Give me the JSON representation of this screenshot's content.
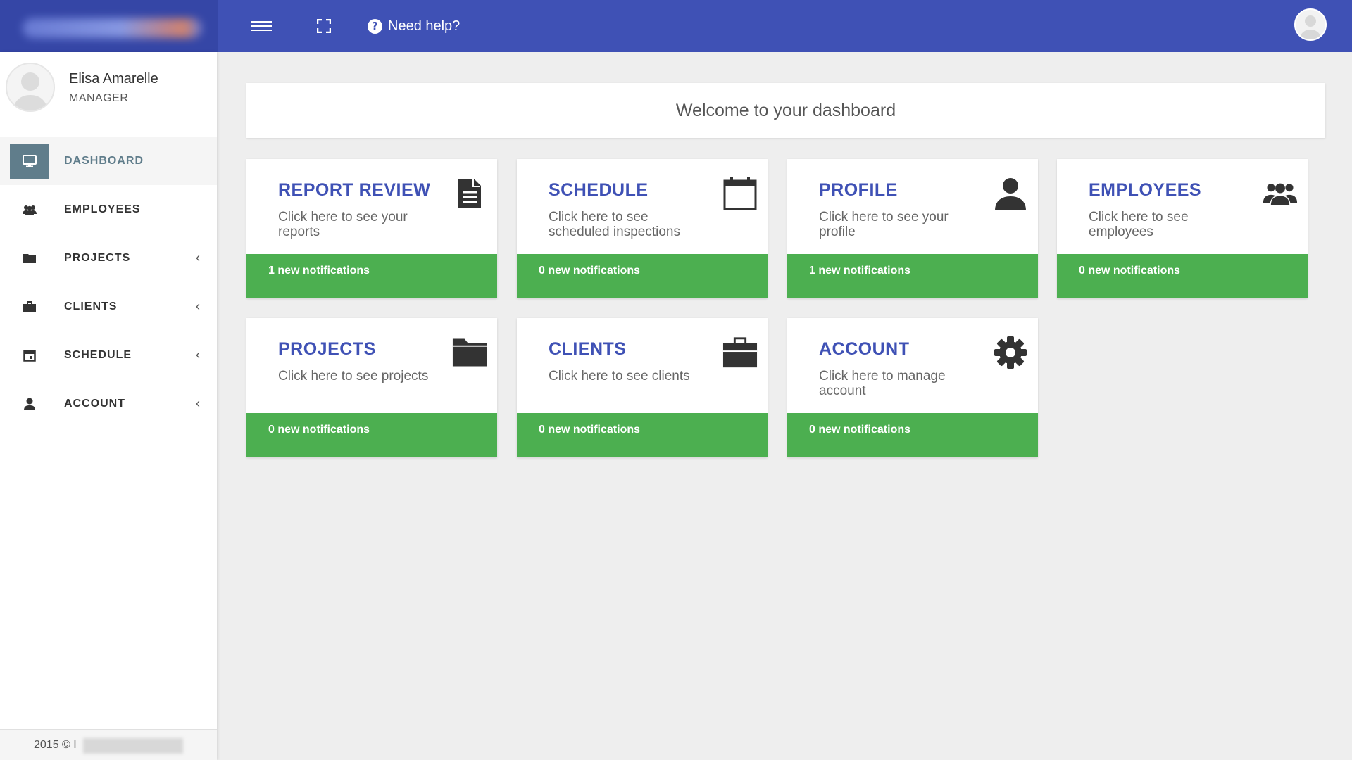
{
  "topbar": {
    "help_label": "Need help?",
    "color": "#3f51b5"
  },
  "user": {
    "name": "Elisa Amarelle",
    "role": "MANAGER"
  },
  "nav": {
    "items": [
      {
        "label": "DASHBOARD",
        "icon": "monitor-icon",
        "active": true
      },
      {
        "label": "EMPLOYEES",
        "icon": "group-icon"
      },
      {
        "label": "PROJECTS",
        "icon": "folder-icon",
        "chevron": "‹"
      },
      {
        "label": "CLIENTS",
        "icon": "briefcase-icon",
        "chevron": "‹"
      },
      {
        "label": "SCHEDULE",
        "icon": "calendar-icon",
        "chevron": "‹"
      },
      {
        "label": "ACCOUNT",
        "icon": "person-icon",
        "chevron": "‹"
      }
    ]
  },
  "footer": {
    "text": "2015 © I"
  },
  "welcome": "Welcome to your dashboard",
  "cards": [
    {
      "title": "REPORT REVIEW",
      "desc": "Click here to see your reports",
      "notifications": "1 new notifications",
      "icon": "document-icon"
    },
    {
      "title": "SCHEDULE",
      "desc": "Click here to see scheduled inspections",
      "notifications": "0 new notifications",
      "icon": "calendar-icon"
    },
    {
      "title": "PROFILE",
      "desc": "Click here to see your profile",
      "notifications": "1 new notifications",
      "icon": "person-icon"
    },
    {
      "title": "EMPLOYEES",
      "desc": "Click here to see employees",
      "notifications": "0 new notifications",
      "icon": "group-icon"
    },
    {
      "title": "PROJECTS",
      "desc": "Click here to see projects",
      "notifications": "0 new notifications",
      "icon": "folder-icon"
    },
    {
      "title": "CLIENTS",
      "desc": "Click here to see clients",
      "notifications": "0 new notifications",
      "icon": "briefcase-icon"
    },
    {
      "title": "ACCOUNT",
      "desc": "Click here to manage account",
      "notifications": "0 new notifications",
      "icon": "gear-icon"
    }
  ],
  "colors": {
    "accent": "#3f51b5",
    "success_bar": "#4caf50",
    "active_nav": "#607d8b"
  }
}
